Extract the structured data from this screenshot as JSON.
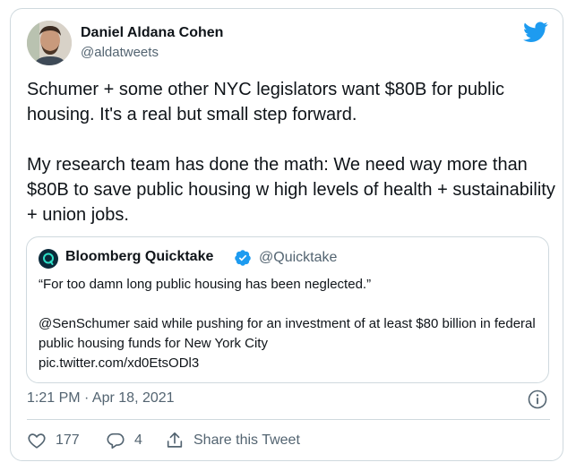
{
  "author": {
    "name": "Daniel Aldana Cohen",
    "handle": "@aldatweets"
  },
  "tweet": {
    "text": "Schumer + some other NYC legislators want $80B for public housing. It's a real but small step forward.\n\nMy research team has done the math: We need way more than $80B to save public housing w high levels of health + sustainability + union jobs."
  },
  "quote": {
    "name": "Bloomberg Quicktake",
    "handle": "@Quicktake",
    "text": "“For too damn long public housing has been neglected.”\n\n@SenSchumer said while pushing for an investment of at least $80 billion in federal public housing funds for New York City\npic.twitter.com/xd0EtsODl3"
  },
  "meta": {
    "timestamp": "1:21 PM · Apr 18, 2021"
  },
  "actions": {
    "likes": "177",
    "replies": "4",
    "share_label": "Share this Tweet"
  },
  "colors": {
    "brand": "#1d9bf0",
    "secondary_text": "#536471",
    "border": "#cfd9de"
  }
}
